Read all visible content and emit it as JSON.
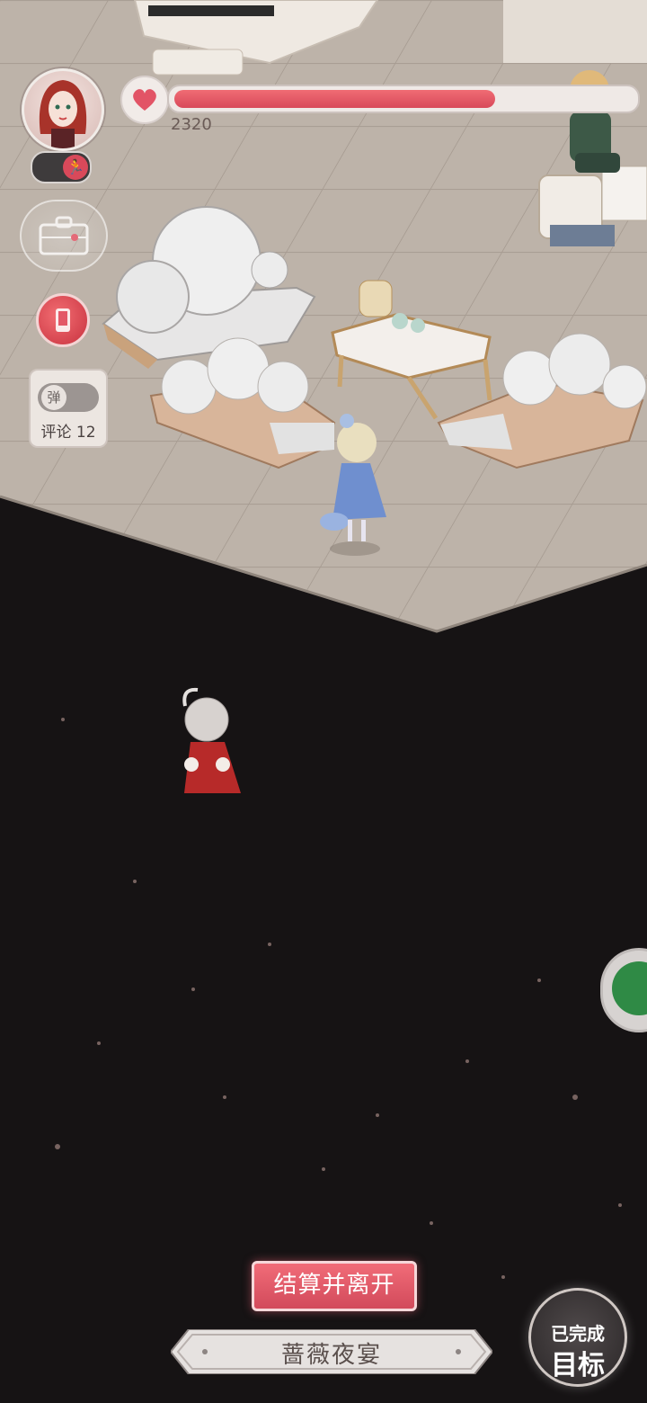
{
  "hud": {
    "hp_value": "2320",
    "hp_fill_fraction": 0.7,
    "comment_label": "评论 12",
    "danmu_label": "弹",
    "icons": [
      "heart-icon",
      "running-icon",
      "suitcase-icon",
      "phone-icon",
      "wechat-icon"
    ]
  },
  "bottom": {
    "settle_button": "结算并离开",
    "location_title": "蔷薇夜宴",
    "goal_status": "已完成",
    "goal_label": "目标"
  },
  "colors": {
    "accent_red": "#d8495a",
    "floor": "#bdb2a8",
    "void": "#161314"
  }
}
